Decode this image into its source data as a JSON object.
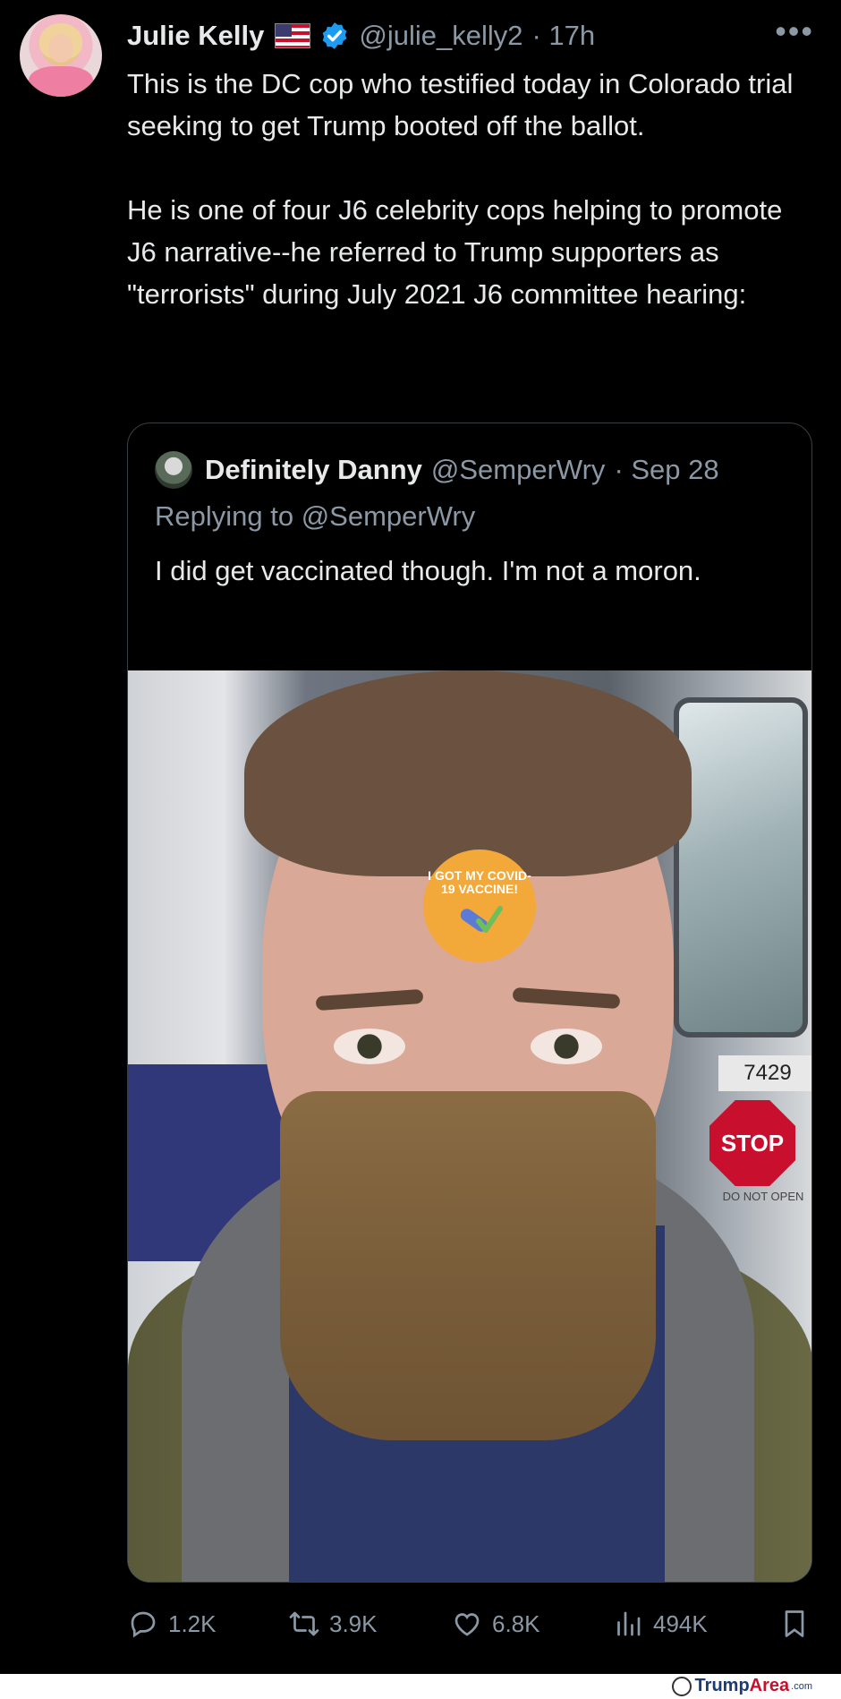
{
  "tweet": {
    "author_name": "Julie Kelly",
    "author_handle": "@julie_kelly2",
    "time": "· 17h",
    "more": "•••",
    "paragraph_1": "This is the DC cop who testified today in Colorado trial seeking to get Trump booted off the ballot.",
    "paragraph_2": "He is one of four J6 celebrity cops helping to promote J6 narrative--he referred to Trump supporters as \"terrorists\" during July 2021 J6 committee hearing:"
  },
  "quote": {
    "author_name": "Definitely Danny",
    "author_handle": "@SemperWry",
    "time": "· Sep 28",
    "replying_to": "Replying to @SemperWry",
    "text": "I did get vaccinated though. I'm not a moron.",
    "photo": {
      "sticker_text": "I GOT MY COVID-19 VACCINE!",
      "car_number": "7429",
      "stop_sign": "STOP",
      "door_notice": "DO NOT OPEN"
    }
  },
  "actions": {
    "replies": "1.2K",
    "retweets": "3.9K",
    "likes": "6.8K",
    "views": "494K"
  },
  "watermark": {
    "part1": "Trump",
    "part2": "Area",
    "suffix": ".com"
  },
  "colors": {
    "background": "#000000",
    "text": "#e7e9ea",
    "secondary": "#8b98a5",
    "verified": "#1d9bf0"
  }
}
